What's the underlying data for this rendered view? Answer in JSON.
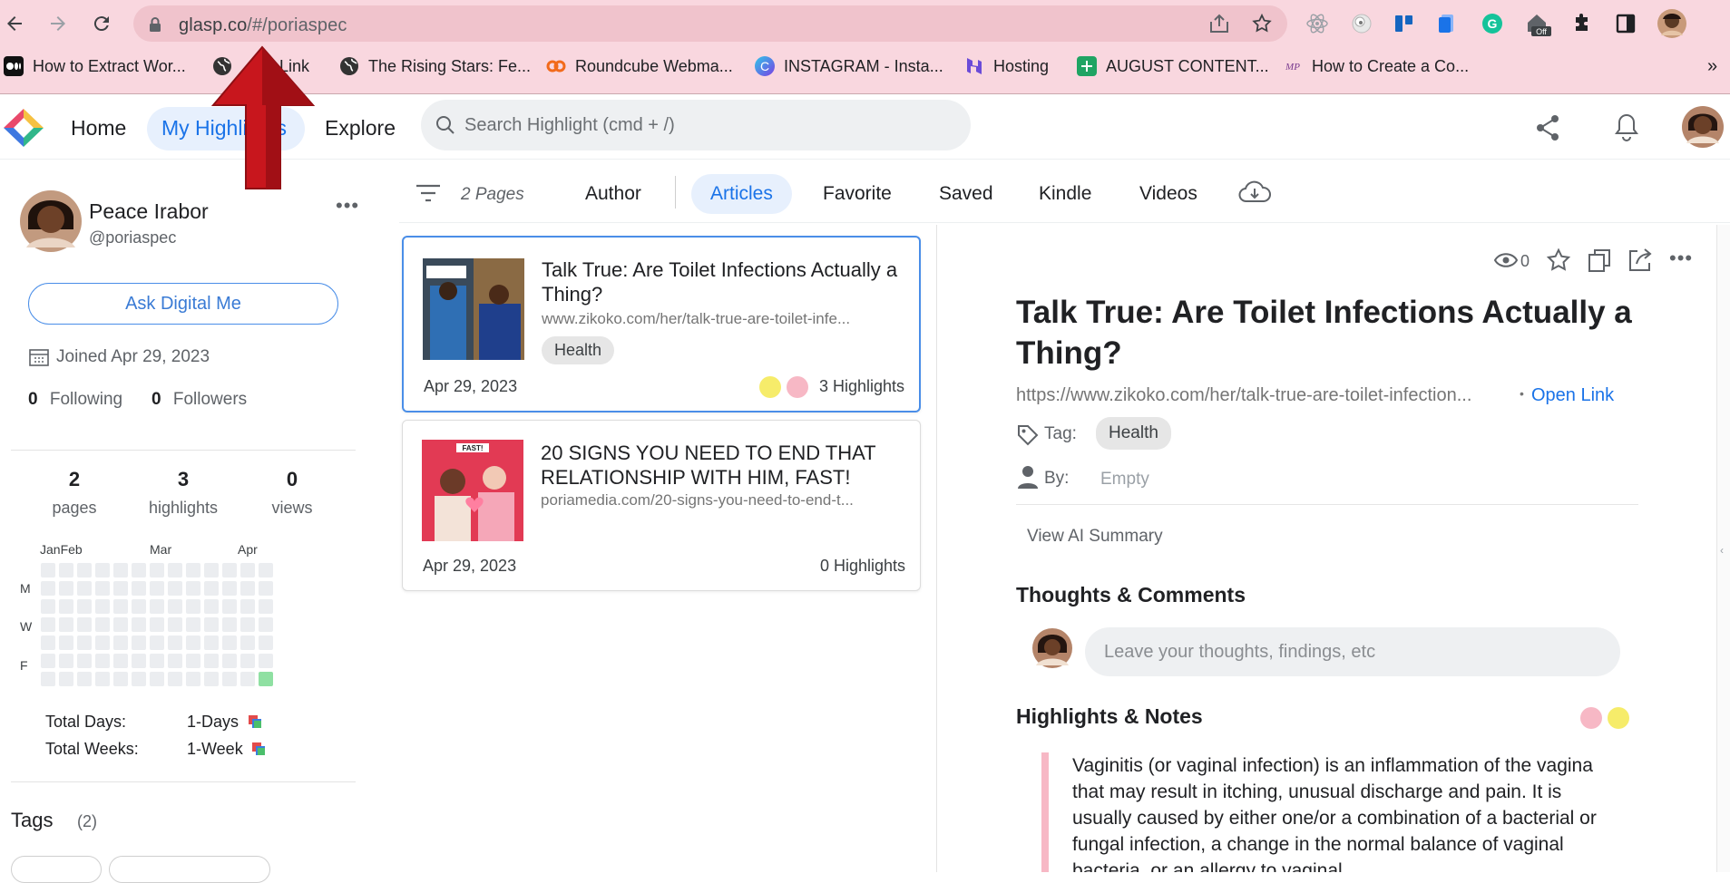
{
  "browser": {
    "url_host": "glasp.co",
    "url_path": "/#/poriaspec",
    "bookmarks": [
      {
        "label": "How to Extract Wor...",
        "color": "#111111",
        "icon": "medium-icon"
      },
      {
        "label": "Link",
        "color": "#333333",
        "icon": "globe-icon"
      },
      {
        "label": "The Rising Stars: Fe...",
        "color": "#333333",
        "icon": "globe-icon"
      },
      {
        "label": "Roundcube Webma...",
        "color": "#f26a1b",
        "icon": "roundcube-icon"
      },
      {
        "label": "INSTAGRAM - Insta...",
        "color": "#3a8dde",
        "icon": "canva-icon"
      },
      {
        "label": "Hosting",
        "color": "#6b4bd8",
        "icon": "hostinger-icon"
      },
      {
        "label": "AUGUST CONTENT...",
        "color": "#1fa463",
        "icon": "sheets-icon"
      },
      {
        "label": "How to Create a Co...",
        "color": "#7a3b8f",
        "icon": "site-icon"
      }
    ],
    "chevron": "»",
    "extension_badge": "Off"
  },
  "app": {
    "nav": {
      "home": "Home",
      "my_highlights": "My Highlights",
      "explore": "Explore"
    },
    "search_placeholder": "Search Highlight (cmd + /)"
  },
  "profile": {
    "name": "Peace Irabor",
    "handle": "@poriaspec",
    "more": "•••",
    "ask_button": "Ask Digital Me",
    "joined": "Joined Apr 29, 2023",
    "following_count": "0",
    "following_label": "Following",
    "followers_count": "0",
    "followers_label": "Followers",
    "stats": [
      {
        "value": "2",
        "label": "pages"
      },
      {
        "value": "3",
        "label": "highlights"
      },
      {
        "value": "0",
        "label": "views"
      }
    ],
    "heatmap": {
      "months": [
        "JanFeb",
        "Mar",
        "Apr"
      ],
      "days": [
        "M",
        "W",
        "F"
      ],
      "active_color": "#8fe0a2"
    },
    "total_days_label": "Total Days:",
    "total_days_value": "1-Days",
    "total_weeks_label": "Total Weeks:",
    "total_weeks_value": "1-Week",
    "tags_title": "Tags",
    "tags_count": "(2)"
  },
  "filters": {
    "pages": "2 Pages",
    "tabs": [
      "Author",
      "Articles",
      "Favorite",
      "Saved",
      "Kindle",
      "Videos"
    ],
    "active": "Articles"
  },
  "articles": [
    {
      "title": "Talk True: Are Toilet Infections Actually a Thing?",
      "url": "www.zikoko.com/her/talk-true-are-toilet-infe...",
      "tag": "Health",
      "date": "Apr 29, 2023",
      "highlights": "3 Highlights",
      "dot_colors": [
        "#f6ec6a",
        "#f7b8c5"
      ]
    },
    {
      "title": "20 SIGNS YOU NEED TO END THAT RELATIONSHIP WITH HIM, FAST!",
      "url": "poriamedia.com/20-signs-you-need-to-end-t...",
      "date": "Apr 29, 2023",
      "highlights": "0 Highlights",
      "thumb_caption": "FAST!"
    }
  ],
  "detail": {
    "views": "0",
    "title": "Talk True: Are Toilet Infections Actually a Thing?",
    "url": "https://www.zikoko.com/her/talk-true-are-toilet-infection...",
    "sep": "•",
    "open_link": "Open Link",
    "tag_label": "Tag:",
    "tag": "Health",
    "by_label": "By:",
    "by_value": "Empty",
    "ai_summary": "View AI Summary",
    "thoughts_title": "Thoughts & Comments",
    "thoughts_placeholder": "Leave your thoughts, findings, etc",
    "highlights_title": "Highlights & Notes",
    "highlight_colors": [
      "#f7b8c5",
      "#f6ec6a"
    ],
    "highlight_text": "Vaginitis (or vaginal infection) is an inflammation of the vagina that may result in itching, unusual discharge and pain. It is usually caused by either one/or a combination of a bacterial or fungal infection, a change in the normal balance of vaginal bacteria, or an allergy to vaginal..."
  },
  "colors": {
    "chrome_bar": "#f9d7df",
    "accent": "#1a73e8",
    "annotation_arrow": "#c8161d"
  }
}
